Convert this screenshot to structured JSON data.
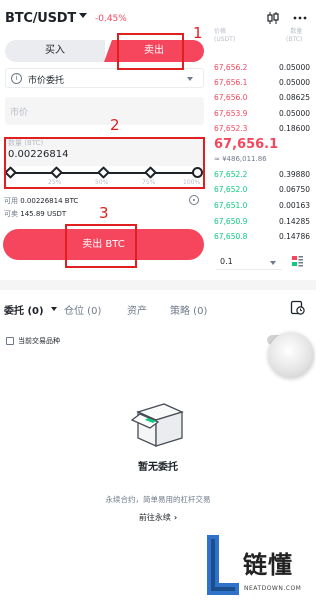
{
  "header": {
    "pair": "BTC/USDT",
    "change": "-0.45%"
  },
  "trade": {
    "buy_label": "买入",
    "sell_label": "卖出",
    "order_type": "市价委托",
    "order_type_info_icon": "info-icon",
    "price_placeholder": "市价",
    "qty_label": "数量 (BTC)",
    "qty_value": "0.00226814",
    "slider_marks": [
      "25%",
      "50%",
      "75%",
      "100%"
    ],
    "slider_level": 1.0,
    "available_label": "可用",
    "available_value": "0.00226814 BTC",
    "sellable_label": "可卖",
    "sellable_value": "145.89 USDT",
    "sell_button": "卖出 BTC"
  },
  "orderbook": {
    "price_header": "价格",
    "price_unit": "(USDT)",
    "qty_header": "数量",
    "qty_unit": "(BTC)",
    "asks": [
      {
        "price": "67,656.2",
        "qty": "0.05000"
      },
      {
        "price": "67,656.1",
        "qty": "0.05000"
      },
      {
        "price": "67,656.0",
        "qty": "0.08625"
      },
      {
        "price": "67,653.9",
        "qty": "0.05000"
      },
      {
        "price": "67,652.3",
        "qty": "0.18600"
      }
    ],
    "last_price": "67,656.1",
    "last_price_cny": "≈ ¥486,011.86",
    "bids": [
      {
        "price": "67,652.2",
        "qty": "0.39880"
      },
      {
        "price": "67,652.0",
        "qty": "0.06750"
      },
      {
        "price": "67,651.0",
        "qty": "0.00163"
      },
      {
        "price": "67,650.9",
        "qty": "0.14285"
      },
      {
        "price": "67,650.8",
        "qty": "0.14786"
      }
    ],
    "precision": "0.1"
  },
  "orders": {
    "tabs": [
      {
        "label": "委托 (0)"
      },
      {
        "label": "仓位 (0)"
      },
      {
        "label": "资产"
      },
      {
        "label": "策略 (0)"
      }
    ],
    "current_only_label": "当前交易品种",
    "empty_title": "暂无委托",
    "empty_sub": "永续合约，简单易用的杠杆交易",
    "empty_link": "前往永续"
  },
  "annotations": [
    "1",
    "2",
    "3"
  ],
  "watermark": {
    "brand_cn": "链懂",
    "brand_en": "NEATDOWN.COM"
  },
  "colors": {
    "sell": "#f6465d",
    "buy": "#0ecb81",
    "annotation": "#e02020"
  }
}
